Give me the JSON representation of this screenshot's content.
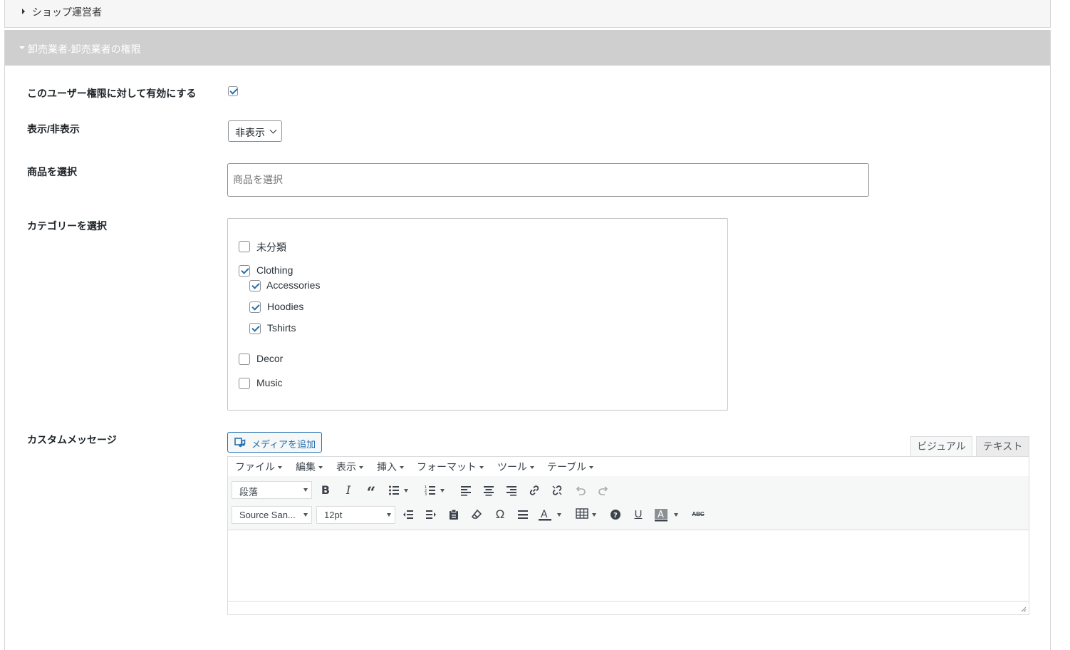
{
  "collapsed_panel": {
    "label": "ショップ運営者"
  },
  "expanded_panel": {
    "label": "卸売業者-卸売業者の権限"
  },
  "fields": {
    "enable": {
      "label": "このユーザー権限に対して有効にする",
      "checked": true
    },
    "visibility": {
      "label": "表示/非表示",
      "value": "非表示"
    },
    "products": {
      "label": "商品を選択",
      "placeholder": "商品を選択"
    },
    "categories": {
      "label": "カテゴリーを選択",
      "items": [
        {
          "label": "未分類",
          "checked": false
        },
        {
          "label": "Clothing",
          "checked": true
        },
        {
          "label": "Accessories",
          "checked": true
        },
        {
          "label": "Hoodies",
          "checked": true
        },
        {
          "label": "Tshirts",
          "checked": true
        },
        {
          "label": "Decor",
          "checked": false
        },
        {
          "label": "Music",
          "checked": false
        }
      ]
    },
    "custom_message": {
      "label": "カスタムメッセージ"
    }
  },
  "editor": {
    "add_media": "メディアを追加",
    "tabs": {
      "visual": "ビジュアル",
      "text": "テキスト"
    },
    "menus": [
      "ファイル",
      "編集",
      "表示",
      "挿入",
      "フォーマット",
      "ツール",
      "テーブル"
    ],
    "paragraph": "段落",
    "font_family": "Source San...",
    "font_size": "12pt",
    "icons": [
      "bold-icon",
      "italic-icon",
      "blockquote-icon",
      "bullet-list-icon",
      "numbered-list-icon",
      "align-left-icon",
      "align-center-icon",
      "align-right-icon",
      "link-icon",
      "unlink-icon",
      "undo-icon",
      "redo-icon",
      "outdent-icon",
      "indent-icon",
      "paste-text-icon",
      "clear-format-icon",
      "omega-icon",
      "horizontal-line-icon",
      "text-color-icon",
      "table-icon",
      "help-icon",
      "underline-icon",
      "background-color-icon",
      "strikethrough-icon"
    ]
  },
  "colors": {
    "accent": "#2271b1",
    "panel_header": "#cfcfcf"
  }
}
